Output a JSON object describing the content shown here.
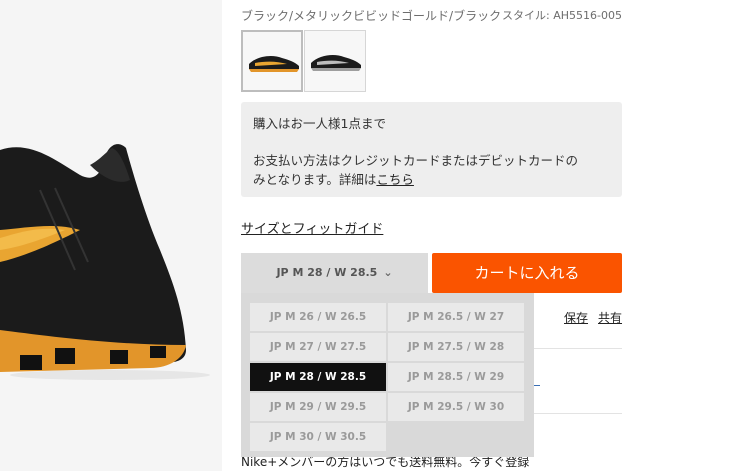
{
  "product": {
    "color_name": "ブラック/メタリックビビッドゴールド/ブラック",
    "style": "スタイル: AH5516-005"
  },
  "notice": {
    "line1": "購入はお一人様1点まで",
    "line2": "お支払い方法はクレジットカードまたはデビットカードの",
    "line3_prefix": "みとなります。詳細は",
    "line3_link": "こちら"
  },
  "size_guide_label": "サイズとフィットガイド",
  "size_select": {
    "selected_label": "JP M 28 / W 28.5",
    "options": [
      "JP M 26 / W 26.5",
      "JP M 26.5 / W 27",
      "JP M 27 / W 27.5",
      "JP M 27.5 / W 28",
      "JP M 28 / W 28.5",
      "JP M 28.5 / W 29",
      "JP M 29 / W 29.5",
      "JP M 29.5 / W 30",
      "JP M 30 / W 30.5"
    ],
    "selected_index": 4
  },
  "cart_button_label": "カートに入れる",
  "save_label": "保存",
  "share_label": "共有",
  "footer_text": "Nike+メンバーの方はいつでも送料無料。今すぐ登録",
  "colors": {
    "accent": "#fa5400",
    "selected_option": "#111111"
  }
}
